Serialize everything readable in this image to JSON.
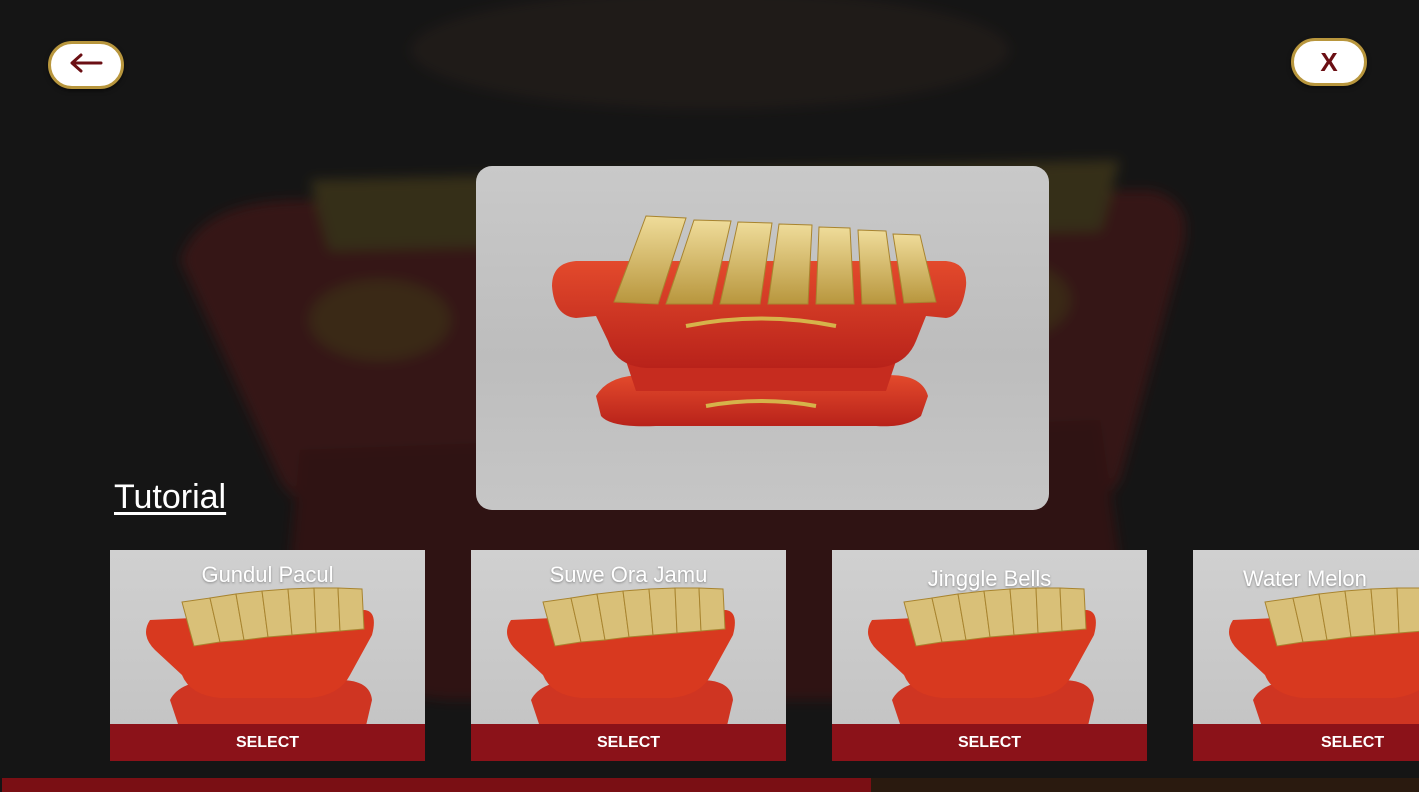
{
  "header": {
    "back_icon": "arrow-left-icon",
    "close_label": "X"
  },
  "colors": {
    "accent_red": "#8b1219",
    "button_border_gold": "#b8963d",
    "close_text": "#6b0f14"
  },
  "preview": {
    "image": "gambang-instrument-3d-render"
  },
  "tutorial": {
    "label": "Tutorial"
  },
  "songs": [
    {
      "title": "Gundul Pacul",
      "select_label": "SELECT"
    },
    {
      "title": "Suwe Ora Jamu",
      "select_label": "SELECT"
    },
    {
      "title": "Jinggle Bells",
      "select_label": "SELECT"
    },
    {
      "title": "Water Melon",
      "select_label": "SELECT"
    }
  ]
}
